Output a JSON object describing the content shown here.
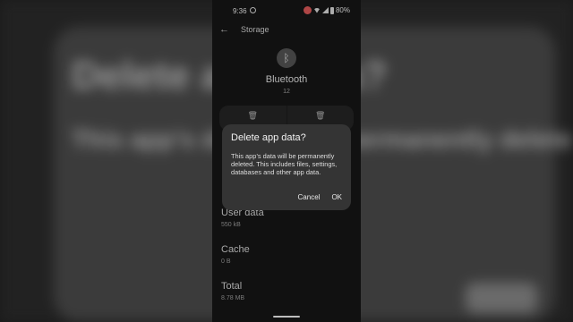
{
  "status_bar": {
    "time": "9:36",
    "battery": "80%"
  },
  "app_bar": {
    "title": "Storage"
  },
  "app": {
    "name": "Bluetooth",
    "version": "12",
    "logo_icon": "bluetooth-icon"
  },
  "actions": {
    "clear_storage_icon": "trash-icon",
    "clear_cache_icon": "trash-icon"
  },
  "storage": [
    {
      "label": "User data",
      "value": "550 kB"
    },
    {
      "label": "Cache",
      "value": "0 B"
    },
    {
      "label": "Total",
      "value": "8.78 MB"
    }
  ],
  "dialog": {
    "title": "Delete app data?",
    "body": "This app’s data will be permanently deleted. This includes files, settings, databases and other app data.",
    "cancel_label": "Cancel",
    "ok_label": "OK"
  },
  "colors": {
    "background": "#161616",
    "dialog": "#343434"
  }
}
